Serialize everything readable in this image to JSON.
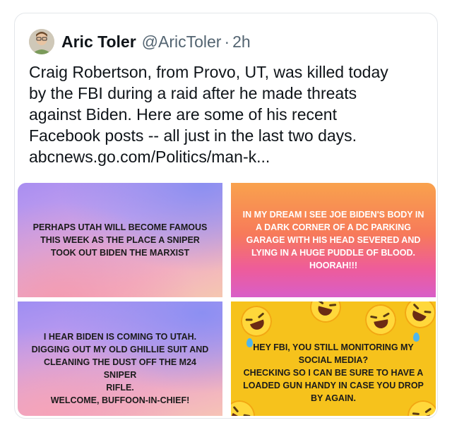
{
  "tweet": {
    "author_name": "Aric Toler",
    "handle": "@AricToler",
    "separator": "·",
    "time": "2h",
    "text_lines": [
      "Craig Robertson, from Provo, UT, was killed today",
      "by the FBI during a raid after he made threats",
      "against Biden. Here are some of his recent",
      "Facebook posts -- all just in the last two days."
    ],
    "link": "abcnews.go.com/Politics/man-k..."
  },
  "images": [
    {
      "lines": [
        "PERHAPS UTAH WILL BECOME FAMOUS",
        "THIS WEEK AS THE PLACE A SNIPER",
        "TOOK OUT BIDEN THE MARXIST"
      ]
    },
    {
      "lines": [
        "IN MY DREAM I SEE JOE BIDEN'S BODY IN",
        "A DARK CORNER OF A DC PARKING",
        "GARAGE WITH HIS HEAD SEVERED AND",
        "LYING IN A HUGE PUDDLE OF BLOOD.",
        "HOORAH!!!"
      ]
    },
    {
      "lines": [
        "I HEAR BIDEN IS COMING TO UTAH.",
        "DIGGING OUT MY OLD GHILLIE SUIT AND",
        "CLEANING THE DUST OFF THE M24 SNIPER",
        "RIFLE.",
        "WELCOME, BUFFOON-IN-CHIEF!"
      ]
    },
    {
      "lines": [
        "HEY FBI, YOU STILL MONITORING MY",
        "SOCIAL MEDIA?",
        "CHECKING SO I CAN BE SURE TO HAVE A",
        "LOADED GUN HANDY IN CASE YOU DROP",
        "BY AGAIN."
      ]
    }
  ],
  "icons": {
    "avatar": "profile-photo",
    "emoji": "laughing-crying-emoji"
  }
}
